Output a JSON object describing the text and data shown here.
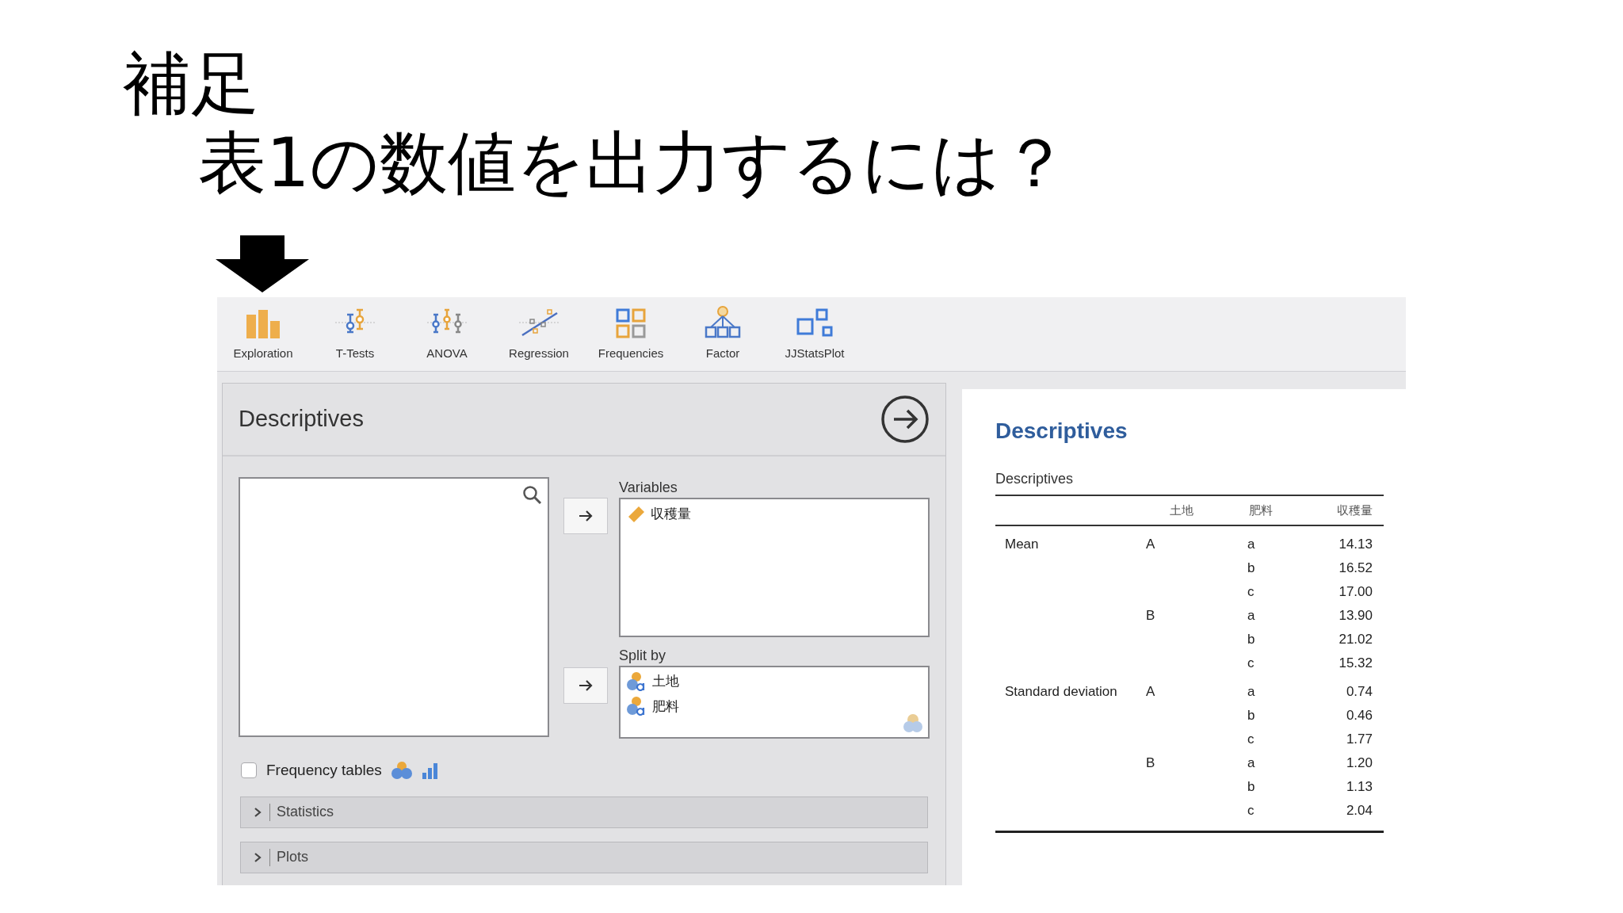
{
  "slide": {
    "heading": "補足",
    "subheading": "表1の数値を出力するには？"
  },
  "toolbar": [
    {
      "label": "Exploration",
      "kind": "bars"
    },
    {
      "label": "T-Tests",
      "kind": "ttest"
    },
    {
      "label": "ANOVA",
      "kind": "anova"
    },
    {
      "label": "Regression",
      "kind": "regression"
    },
    {
      "label": "Frequencies",
      "kind": "grid"
    },
    {
      "label": "Factor",
      "kind": "tree"
    },
    {
      "label": "JJStatsPlot",
      "kind": "squares"
    }
  ],
  "options_panel": {
    "title": "Descriptives",
    "variables": {
      "label": "Variables",
      "items": [
        {
          "name": "収穫量",
          "kind": "scale"
        }
      ]
    },
    "split_by": {
      "label": "Split by",
      "items": [
        {
          "name": "土地",
          "kind": "nominal"
        },
        {
          "name": "肥料",
          "kind": "nominal"
        }
      ]
    },
    "frequency_tables": {
      "label": "Frequency tables",
      "checked": false
    },
    "sections": [
      {
        "label": "Statistics",
        "expanded": false
      },
      {
        "label": "Plots",
        "expanded": false
      }
    ]
  },
  "results": {
    "title": "Descriptives",
    "table_title": "Descriptives",
    "columns": [
      "土地",
      "肥料",
      "収穫量"
    ],
    "rows": [
      {
        "statistic": "Mean",
        "land": "A",
        "fertilizer": "a",
        "value": "14.13"
      },
      {
        "fertilizer": "b",
        "value": "16.52"
      },
      {
        "fertilizer": "c",
        "value": "17.00"
      },
      {
        "land": "B",
        "fertilizer": "a",
        "value": "13.90"
      },
      {
        "fertilizer": "b",
        "value": "21.02"
      },
      {
        "fertilizer": "c",
        "value": "15.32"
      },
      {
        "statistic": "Standard deviation",
        "land": "A",
        "fertilizer": "a",
        "value": "0.74"
      },
      {
        "fertilizer": "b",
        "value": "0.46"
      },
      {
        "fertilizer": "c",
        "value": "1.77"
      },
      {
        "land": "B",
        "fertilizer": "a",
        "value": "1.20"
      },
      {
        "fertilizer": "b",
        "value": "1.13"
      },
      {
        "fertilizer": "c",
        "value": "2.04"
      }
    ]
  }
}
